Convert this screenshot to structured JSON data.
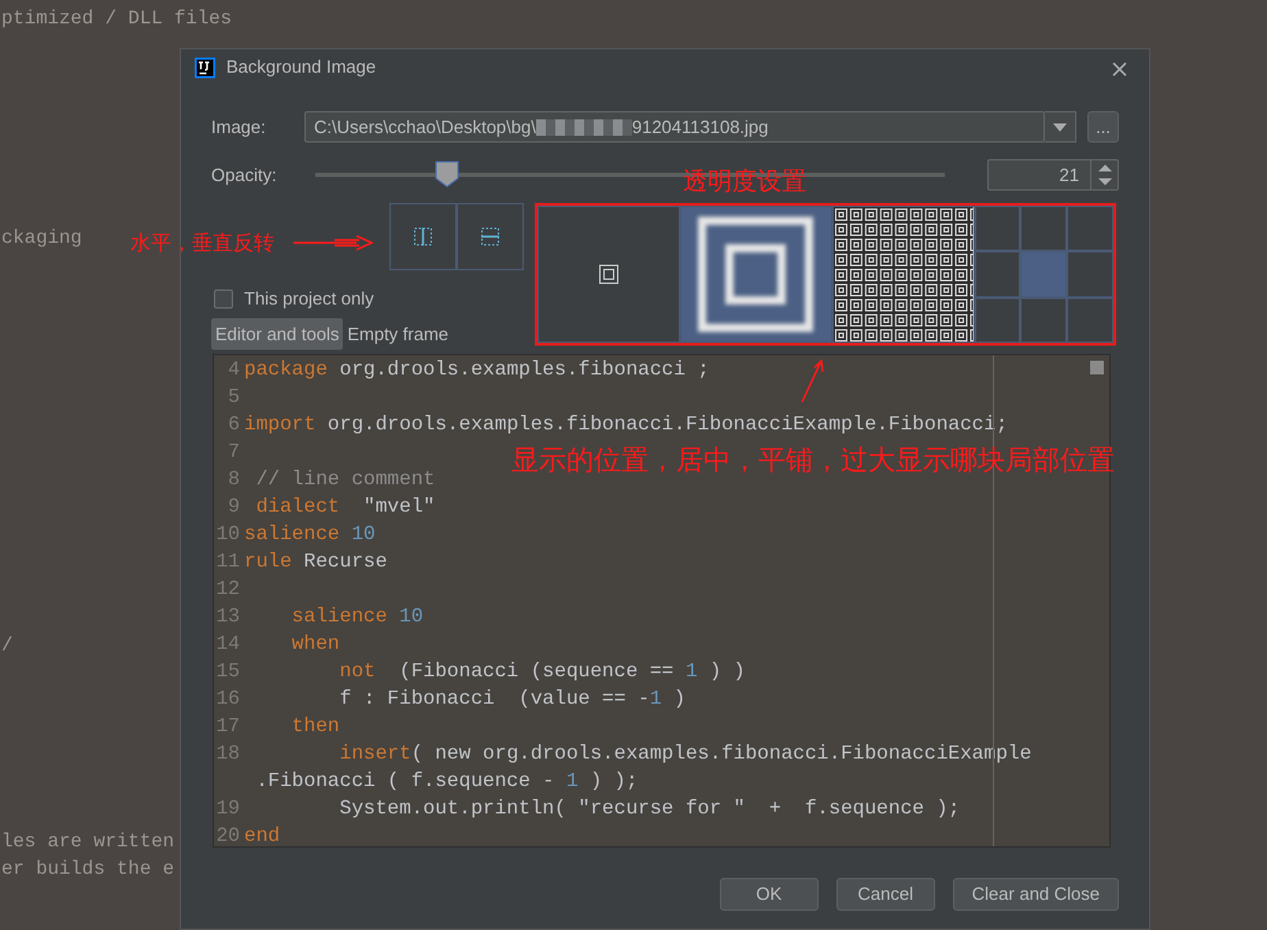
{
  "background_editor": {
    "lines": [
      "ptimized / DLL files",
      "ckaging",
      "/",
      "les are written",
      "er builds the e"
    ]
  },
  "dialog": {
    "title": "Background Image",
    "image": {
      "label": "Image:",
      "value_start": "C:\\Users\\cchao\\Desktop\\bg\\",
      "value_end": "91204113108.jpg",
      "masked": true,
      "browse_label": "..."
    },
    "opacity": {
      "label": "Opacity:",
      "level": 0.21,
      "value": "21"
    },
    "flip_buttons": [
      {
        "kind": "horizontal",
        "selected": false
      },
      {
        "kind": "vertical",
        "selected": false
      }
    ],
    "this_project_only": {
      "label": "This project only",
      "checked": false
    },
    "tabs": [
      {
        "label": "Editor and tools",
        "selected": true
      },
      {
        "label": "Empty frame",
        "selected": false
      }
    ],
    "placement": [
      {
        "kind": "center",
        "selected": false
      },
      {
        "kind": "scale",
        "selected": true
      },
      {
        "kind": "tile",
        "selected": false
      },
      {
        "kind": "anchor",
        "selected": false,
        "cells": [
          {
            "selected": false
          },
          {
            "selected": false
          },
          {
            "selected": false
          },
          {
            "selected": false
          },
          {
            "selected": true
          },
          {
            "selected": false
          },
          {
            "selected": false
          },
          {
            "selected": false
          },
          {
            "selected": false
          }
        ]
      }
    ],
    "preview": {
      "lines": [
        {
          "number": "4",
          "tokens": [
            {
              "kind": "keyword",
              "text": "package"
            },
            {
              "kind": "plain",
              "text": " org.drools.examples.fibonacci ;"
            }
          ]
        },
        {
          "number": "5"
        },
        {
          "number": "6",
          "tokens": [
            {
              "kind": "keyword",
              "text": "import"
            },
            {
              "kind": "plain",
              "text": " org.drools.examples.fibonacci.FibonacciExample.Fibonacci;"
            }
          ]
        },
        {
          "number": "7"
        },
        {
          "number": "8",
          "tokens": [
            {
              "kind": "comment",
              "text": " // line comment"
            }
          ]
        },
        {
          "number": "9",
          "tokens": [
            {
              "kind": "keyword",
              "text": " dialect"
            },
            {
              "kind": "plain",
              "text": "  \"mvel\""
            }
          ]
        },
        {
          "number": "10",
          "tokens": [
            {
              "kind": "keyword",
              "text": "salience"
            },
            {
              "kind": "number",
              "text": " 10"
            }
          ]
        },
        {
          "number": "11",
          "tokens": [
            {
              "kind": "keyword",
              "text": "rule"
            },
            {
              "kind": "plain",
              "text": " Recurse"
            }
          ]
        },
        {
          "number": "12"
        },
        {
          "number": "13",
          "tokens": [
            {
              "kind": "keyword",
              "text": "    salience"
            },
            {
              "kind": "number",
              "text": " 10"
            }
          ]
        },
        {
          "number": "14",
          "tokens": [
            {
              "kind": "keyword",
              "text": "    when"
            }
          ]
        },
        {
          "number": "15",
          "tokens": [
            {
              "kind": "keyword",
              "text": "        not"
            },
            {
              "kind": "plain",
              "text": "  (Fibonacci (sequence == "
            },
            {
              "kind": "number",
              "text": "1"
            },
            {
              "kind": "plain",
              "text": " ) )"
            }
          ]
        },
        {
          "number": "16",
          "tokens": [
            {
              "kind": "plain",
              "text": "        f : Fibonacci  (value == -"
            },
            {
              "kind": "number",
              "text": "1"
            },
            {
              "kind": "plain",
              "text": " )"
            }
          ]
        },
        {
          "number": "17",
          "tokens": [
            {
              "kind": "keyword",
              "text": "    then"
            }
          ]
        },
        {
          "number": "18",
          "tokens": [
            {
              "kind": "keyword",
              "text": "        insert"
            },
            {
              "kind": "plain",
              "text": "( new org.drools.examples.fibonacci.FibonacciExample"
            }
          ],
          "wrap_tokens": [
            {
              "kind": "plain",
              "text": " .Fibonacci ( f.sequence - "
            },
            {
              "kind": "number",
              "text": "1"
            },
            {
              "kind": "plain",
              "text": " ) );"
            }
          ]
        },
        {
          "number": "19",
          "tokens": [
            {
              "kind": "plain",
              "text": "        System.out.println( \"recurse for \"  +  f.sequence );"
            }
          ]
        },
        {
          "number": "20",
          "tokens": [
            {
              "kind": "keyword",
              "text": "end"
            }
          ]
        }
      ]
    },
    "buttons": [
      {
        "label": "OK"
      },
      {
        "label": "Cancel"
      },
      {
        "label": "Clear and Close"
      }
    ]
  },
  "annotations": [
    {
      "text": "水平，垂直反转"
    },
    {
      "text": "透明度设置"
    },
    {
      "text": "显示的位置，居中，平铺，过大显示哪块局部位置"
    }
  ]
}
